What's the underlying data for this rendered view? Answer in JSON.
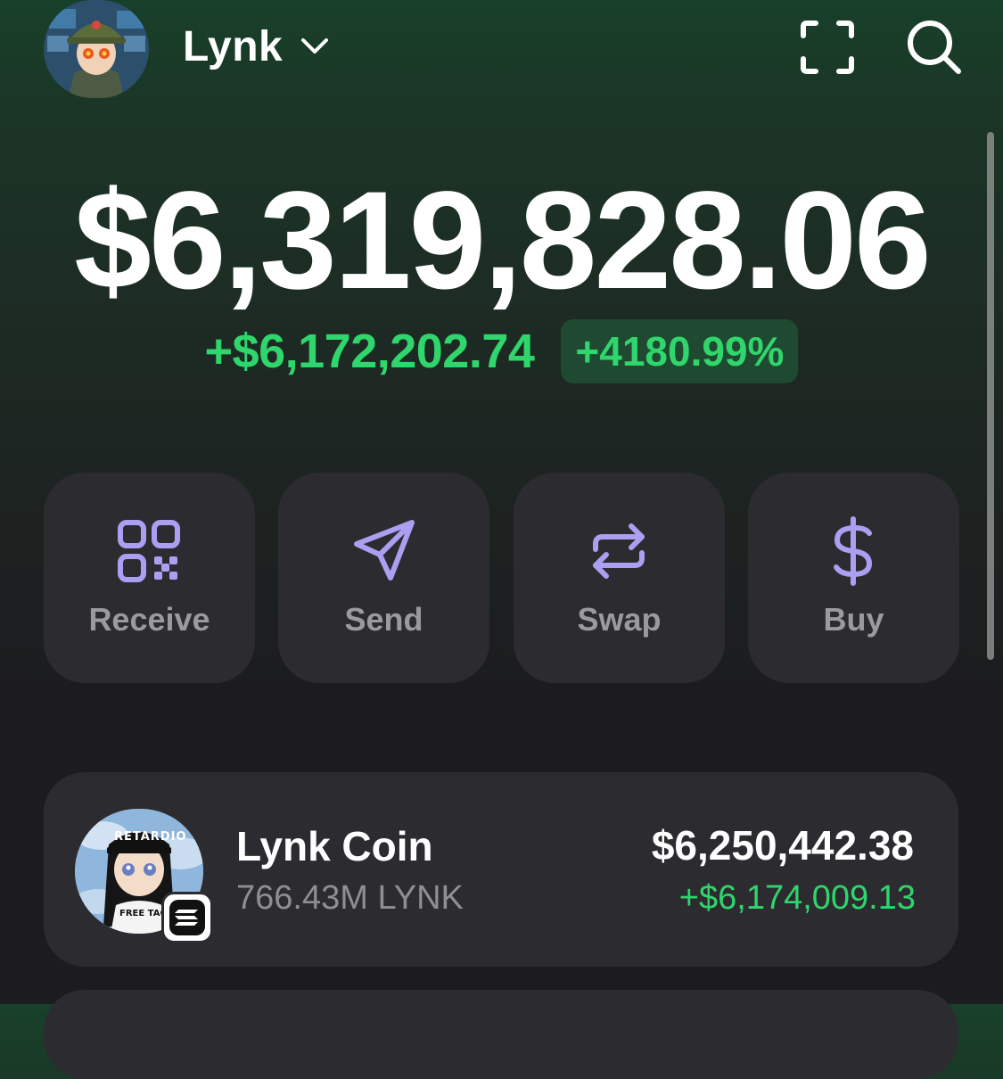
{
  "header": {
    "account_name": "Lynk",
    "avatar_icon": "profile-avatar",
    "account_chevron_icon": "chevron-down-icon",
    "scan_icon": "scan-qr-icon",
    "search_icon": "search-icon"
  },
  "balance": {
    "total": "$6,319,828.06",
    "change_amount": "+$6,172,202.74",
    "change_percent": "+4180.99%"
  },
  "actions": [
    {
      "label": "Receive",
      "icon": "qr-code-icon"
    },
    {
      "label": "Send",
      "icon": "send-icon"
    },
    {
      "label": "Swap",
      "icon": "swap-icon"
    },
    {
      "label": "Buy",
      "icon": "dollar-icon"
    }
  ],
  "tokens": [
    {
      "name": "Lynk Coin",
      "amount": "766.43M LYNK",
      "value": "$6,250,442.38",
      "change": "+$6,174,009.13",
      "chain_badge_icon": "solana-icon",
      "avatar_text": "RETARDIO",
      "shirt_text": "FREE TACO"
    }
  ],
  "colors": {
    "positive": "#2fd66c",
    "positive_bg": "#1f4a31",
    "accent_icon": "#ab9ff2",
    "card_bg": "#2c2c30",
    "label_gray": "#9a9a9f"
  }
}
